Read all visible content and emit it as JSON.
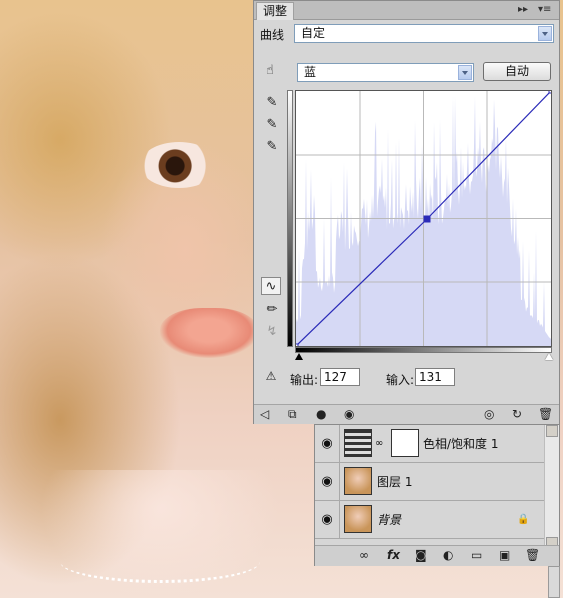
{
  "adjustments": {
    "tab_title": "调整",
    "preset_label": "曲线",
    "preset_value": "自定",
    "channel_value": "蓝",
    "auto_label": "自动",
    "output_label": "输出:",
    "output_value": "127",
    "input_label": "输入:",
    "input_value": "131"
  },
  "curve": {
    "points": [
      [
        0,
        0
      ],
      [
        131,
        127
      ],
      [
        255,
        255
      ]
    ],
    "accent_color": "#2b2bb8",
    "histogram_color": "#d6d9f5"
  },
  "layers": {
    "items": [
      {
        "name": "色相/饱和度 1",
        "type": "adjustment",
        "visible": true
      },
      {
        "name": "图层 1",
        "type": "image",
        "visible": true
      },
      {
        "name": "背景",
        "type": "image",
        "visible": true,
        "locked": true
      }
    ]
  },
  "icons": {
    "panel_expand": "double-arrow-icon",
    "panel_menu": "menu-icon",
    "eye": "eye-icon",
    "lock": "lock-icon",
    "link": "link-icon",
    "fx": "fx-icon"
  }
}
